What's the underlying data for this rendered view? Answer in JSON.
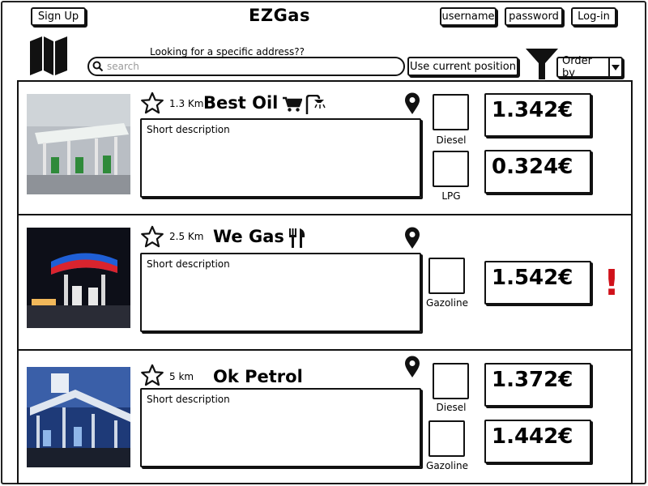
{
  "app": {
    "title": "EZGas"
  },
  "header": {
    "signup_label": "Sign Up",
    "username_label": "username",
    "password_label": "password",
    "login_label": "Log-in"
  },
  "search": {
    "label": "Looking for a specific address??",
    "placeholder": "search",
    "use_position_label": "Use current position",
    "order_by_label": "Order by"
  },
  "colors": {
    "alert": "#d0111a",
    "border": "#111111"
  },
  "stations": [
    {
      "name": "Best Oil",
      "distance": "1.3 Km",
      "description": "Short description",
      "services": [
        "cart-icon",
        "shower-icon"
      ],
      "fuels": [
        {
          "type": "Diesel",
          "price": "1.342€"
        },
        {
          "type": "LPG",
          "price": "0.324€"
        }
      ],
      "alert": false
    },
    {
      "name": "We Gas",
      "distance": "2.5 Km",
      "description": "Short description",
      "services": [
        "fork-knife-icon"
      ],
      "fuels": [
        {
          "type": "Gazoline",
          "price": "1.542€"
        }
      ],
      "alert": true,
      "alert_symbol": "!"
    },
    {
      "name": "Ok Petrol",
      "distance": "5 km",
      "description": "Short description",
      "services": [],
      "fuels": [
        {
          "type": "Diesel",
          "price": "1.372€"
        },
        {
          "type": "Gazoline",
          "price": "1.442€"
        }
      ],
      "alert": false
    }
  ]
}
